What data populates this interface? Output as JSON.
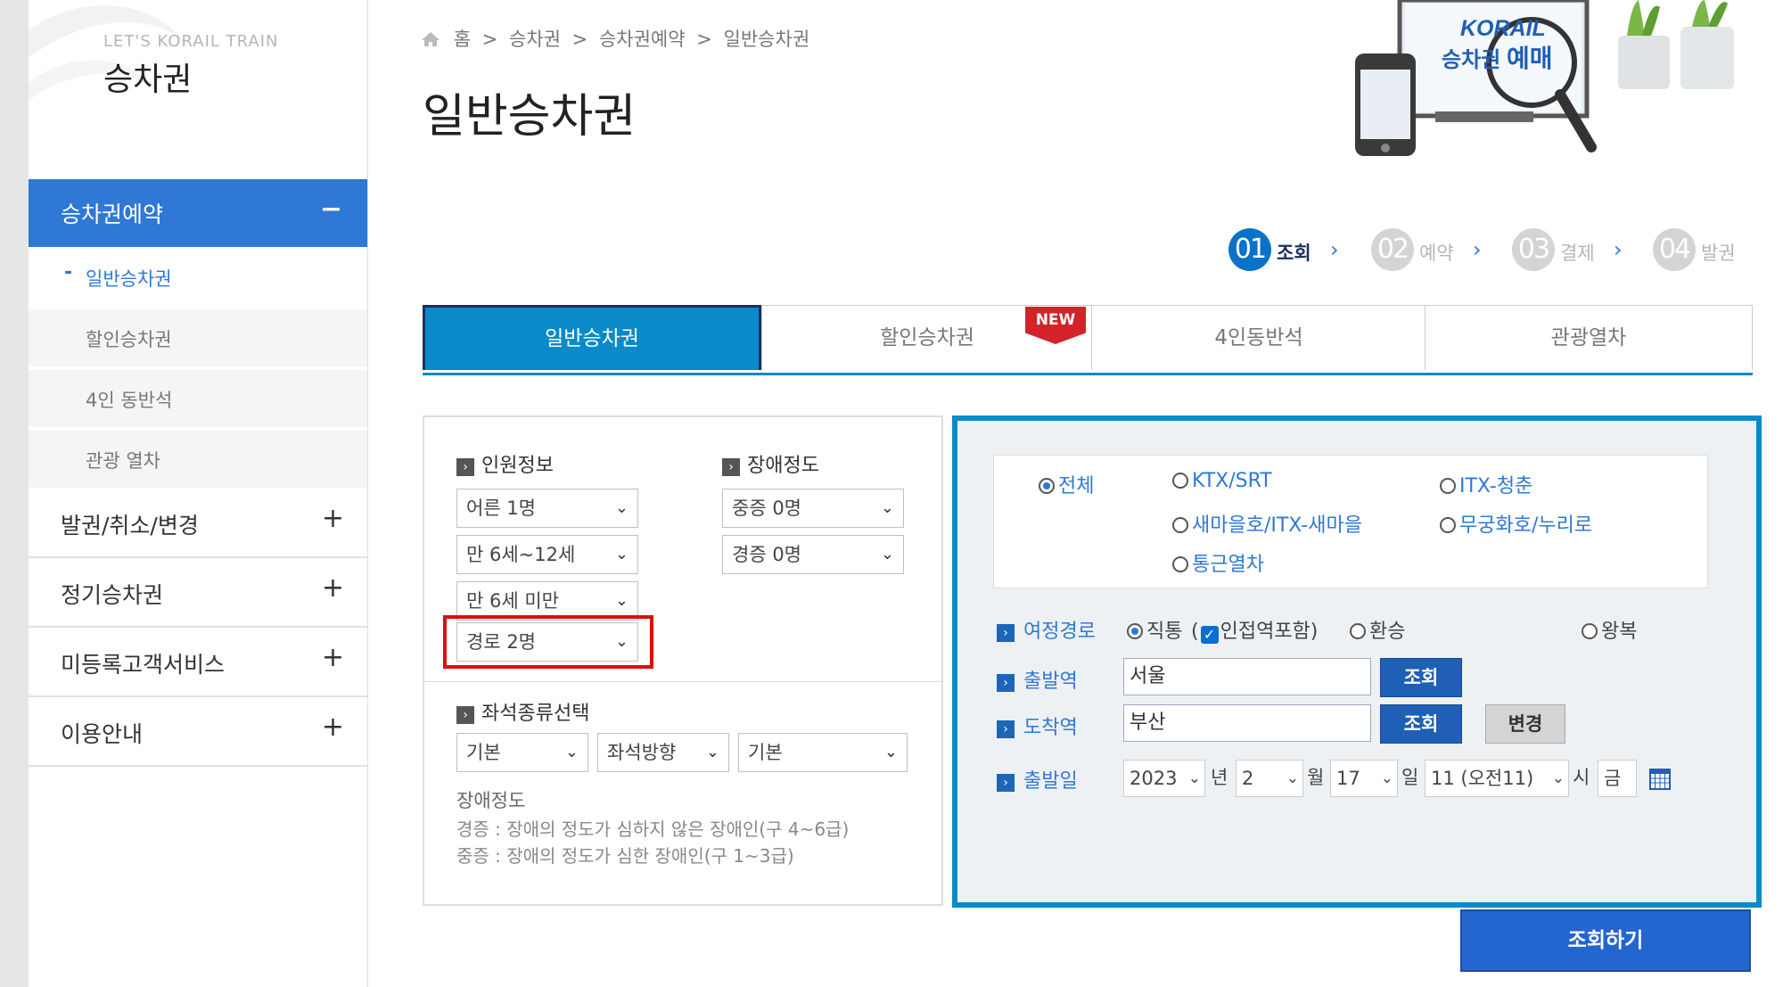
{
  "sidebar": {
    "subtitle": "LET'S KORAIL TRAIN",
    "title": "승차권",
    "active_menu": {
      "label": "승차권예약",
      "sign": "−"
    },
    "sub_items": [
      {
        "label": "일반승차권",
        "prefix": "-"
      },
      {
        "label": "할인승차권"
      },
      {
        "label": "4인 동반석"
      },
      {
        "label": "관광 열차"
      }
    ],
    "menus": [
      {
        "label": "발권/취소/변경",
        "sign": "+"
      },
      {
        "label": "정기승차권",
        "sign": "+"
      },
      {
        "label": "미등록고객서비스",
        "sign": "+"
      },
      {
        "label": "이용안내",
        "sign": "+"
      }
    ]
  },
  "breadcrumb": [
    "홈",
    ">",
    "승차권",
    ">",
    "승차권예약",
    ">",
    "일반승차권"
  ],
  "page_title": "일반승차권",
  "banner": {
    "brand": "KORAIL",
    "text1": "승차권",
    "text2": "예매"
  },
  "steps": [
    {
      "num": "01",
      "label": "조회",
      "arrow": "›"
    },
    {
      "num": "02",
      "label": "예약",
      "arrow": "›"
    },
    {
      "num": "03",
      "label": "결제",
      "arrow": "›"
    },
    {
      "num": "04",
      "label": "발권"
    }
  ],
  "tabs": [
    "일반승차권",
    "할인승차권",
    "4인동반석",
    "관광열차"
  ],
  "new_badge": "NEW",
  "passengers": {
    "heading": "인원정보",
    "adult": "어른 1명",
    "child": "만 6세~12세",
    "infant": "만 6세 미만",
    "senior": "경로 2명"
  },
  "disability": {
    "heading": "장애정도",
    "severe": "중증 0명",
    "mild": "경증 0명"
  },
  "seat": {
    "heading": "좌석종류선택",
    "type": "기본",
    "direction": "좌석방향",
    "option": "기본"
  },
  "notes": {
    "title": "장애정도",
    "mild": "경증 : 장애의 정도가 심하지 않은 장애인(구 4~6급)",
    "severe": "중증 : 장애의 정도가 심한 장애인(구 1~3급)"
  },
  "train_types": {
    "all": "전체",
    "ktx": "KTX/SRT",
    "itx_cheongchun": "ITX-청춘",
    "saemaeul": "새마을호/ITX-새마을",
    "mugunghwa": "무궁화호/누리로",
    "commuter": "통근열차"
  },
  "route": {
    "label": "여정경로",
    "direct": "직통",
    "adjacent_open": "(",
    "adjacent": "인접역포함)",
    "transfer": "환승",
    "round": "왕복"
  },
  "departure": {
    "label": "출발역",
    "value": "서울",
    "button": "조회"
  },
  "arrival": {
    "label": "도착역",
    "value": "부산",
    "button": "조회",
    "swap": "변경"
  },
  "date": {
    "label": "출발일",
    "year": "2023",
    "year_unit": "년",
    "month": "2",
    "month_unit": "월",
    "day": "17",
    "day_unit": "일",
    "hour": "11 (오전11)",
    "hour_unit": "시",
    "weekday": "금"
  },
  "search_button": "조회하기",
  "colors": {
    "primary_blue": "#2f78d5",
    "tab_blue": "#0b8ac9",
    "navy": "#1c2f62",
    "highlight_red": "#e20b0b",
    "badge_red": "#d12329"
  }
}
